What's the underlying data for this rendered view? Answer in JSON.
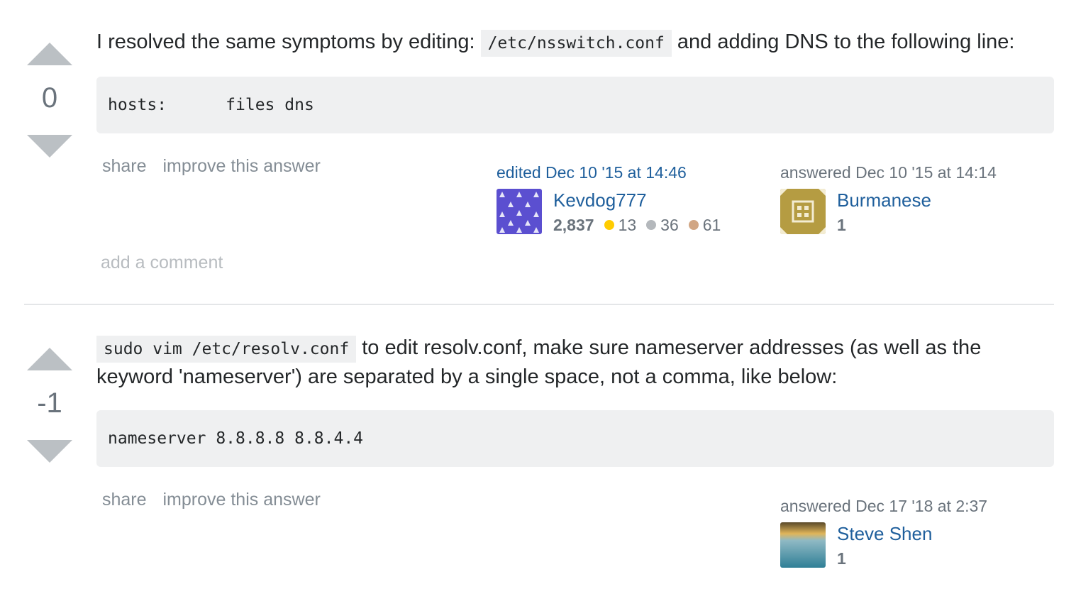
{
  "answers": [
    {
      "votes": "0",
      "text_before": "I resolved the same symptoms by editing: ",
      "inline_code": "/etc/nsswitch.conf",
      "text_after": " and adding DNS to the following line:",
      "code_block": "hosts:      files dns",
      "menu": {
        "share": "share",
        "improve": "improve this answer"
      },
      "editor": {
        "action": "edited Dec 10 '15 at 14:46",
        "name": "Kevdog777",
        "reputation": "2,837",
        "gold": "13",
        "silver": "36",
        "bronze": "61",
        "avatar_color": "#5b4fd0"
      },
      "author": {
        "action": "answered Dec 10 '15 at 14:14",
        "name": "Burmanese",
        "reputation": "1",
        "avatar_color": "#b59c42"
      },
      "add_comment": "add a comment"
    },
    {
      "votes": "-1",
      "inline_code": "sudo vim /etc/resolv.conf",
      "text_line1": " to edit resolv.conf, make sure nameserver addresses (as well as the",
      "text_line2": "keyword 'nameserver') are separated by a single space, not a comma, like below:",
      "code_block": "nameserver 8.8.8.8 8.8.4.4",
      "menu": {
        "share": "share",
        "improve": "improve this answer"
      },
      "author": {
        "action": "answered Dec 17 '18 at 2:37",
        "name": "Steve Shen",
        "reputation": "1"
      }
    }
  ]
}
